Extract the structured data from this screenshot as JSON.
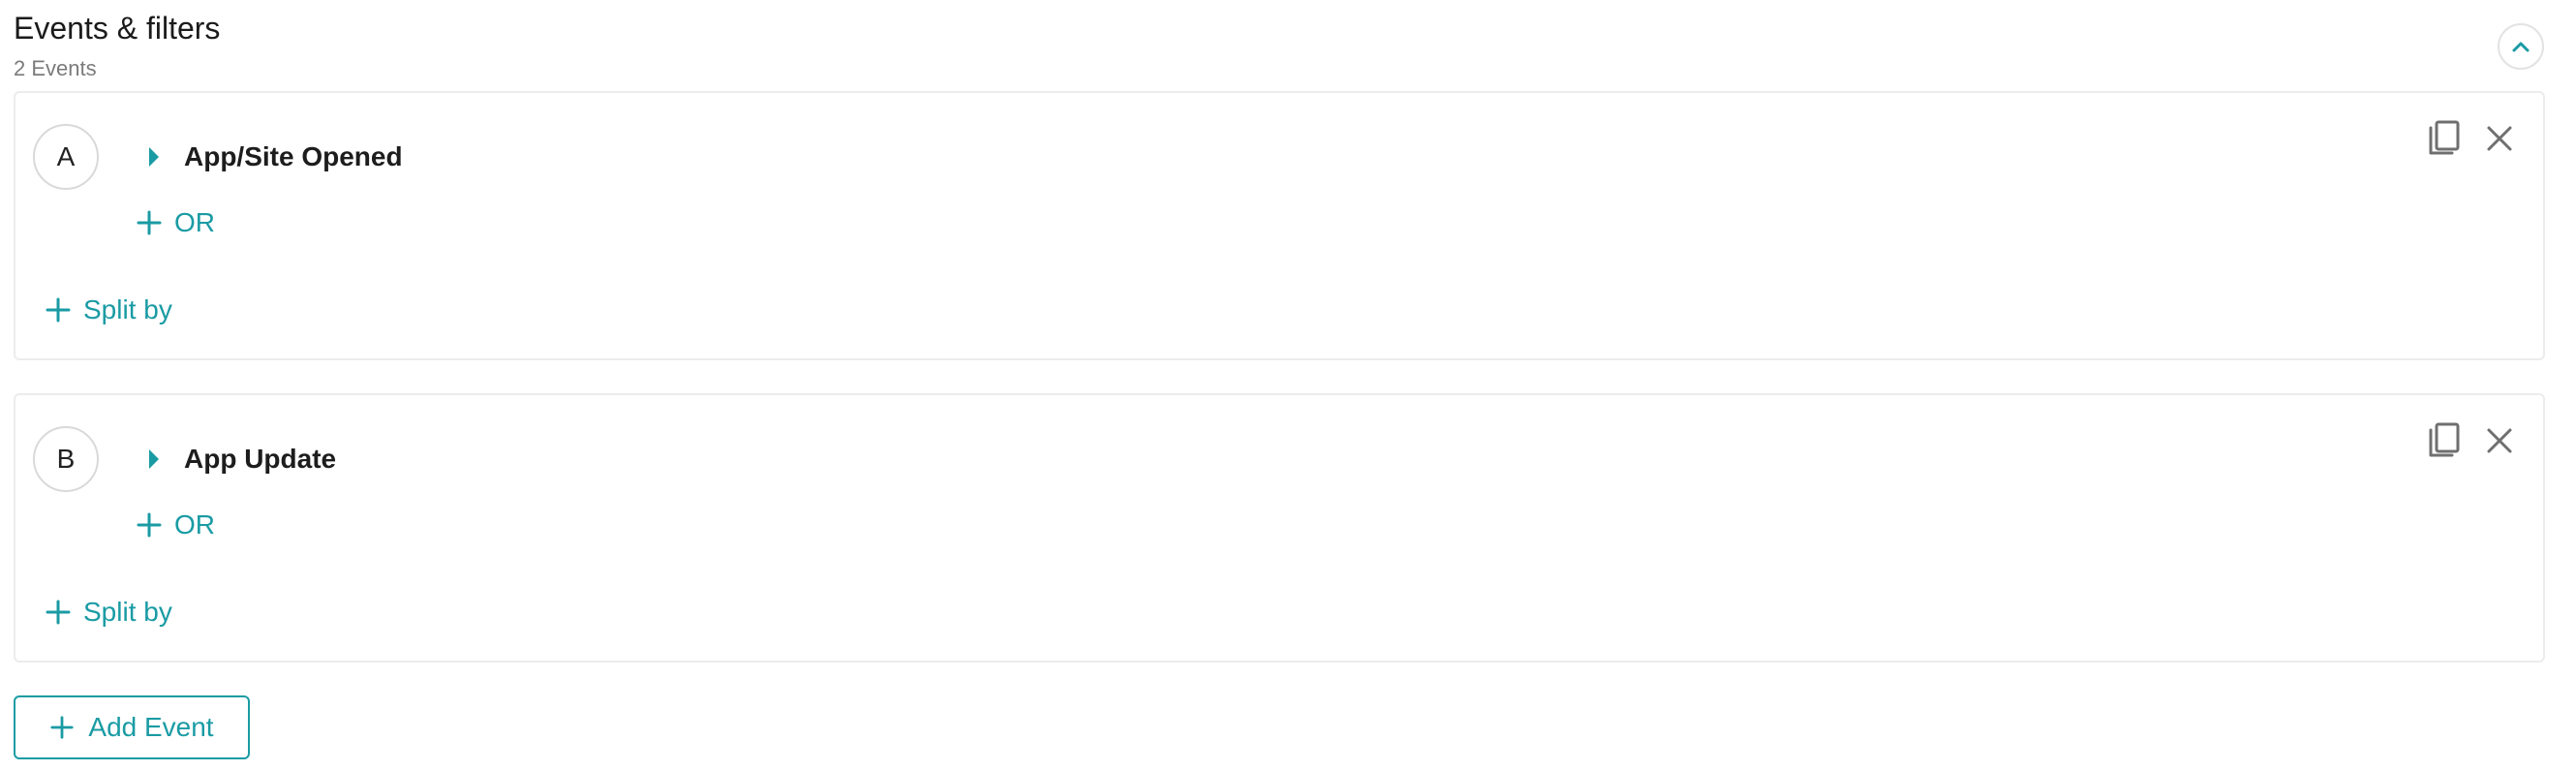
{
  "header": {
    "title": "Events & filters",
    "subtitle": "2 Events"
  },
  "events": [
    {
      "letter": "A",
      "name": "App/Site Opened",
      "or_label": "OR",
      "split_label": "Split by"
    },
    {
      "letter": "B",
      "name": "App Update",
      "or_label": "OR",
      "split_label": "Split by"
    }
  ],
  "add_event_label": "Add Event",
  "icons": {
    "collapse": "chevron-up-icon",
    "expand_event": "caret-right-icon",
    "add": "plus-icon",
    "duplicate": "copy-icon",
    "remove": "close-icon"
  },
  "colors": {
    "accent": "#1a9ba4",
    "icon_gray": "#6f6f6f",
    "border": "#ececec"
  }
}
